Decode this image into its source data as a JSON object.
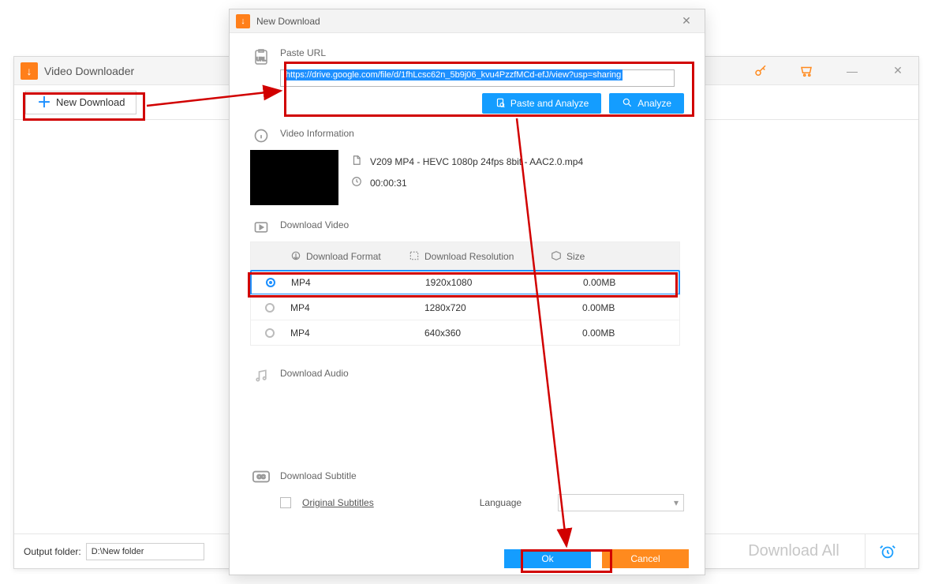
{
  "main": {
    "app_title": "Video Downloader",
    "new_download_btn": "New Download",
    "output_label": "Output folder:",
    "output_path": "D:\\New folder",
    "download_all": "Download All"
  },
  "dialog": {
    "title": "New Download",
    "paste_url_label": "Paste URL",
    "url_value": "https://drive.google.com/file/d/1fhLcsc62n_5b9j06_kvu4PzzfMCd-efJ/view?usp=sharing",
    "paste_analyze_btn": "Paste and Analyze",
    "analyze_btn": "Analyze",
    "video_info_label": "Video Information",
    "video_filename": "V209 MP4 - HEVC 1080p 24fps 8bit - AAC2.0.mp4",
    "video_duration": "00:00:31",
    "download_video_label": "Download Video",
    "col_format": "Download Format",
    "col_resolution": "Download Resolution",
    "col_size": "Size",
    "formats": [
      {
        "format": "MP4",
        "resolution": "1920x1080",
        "size": "0.00MB",
        "selected": true
      },
      {
        "format": "MP4",
        "resolution": "1280x720",
        "size": "0.00MB",
        "selected": false
      },
      {
        "format": "MP4",
        "resolution": "640x360",
        "size": "0.00MB",
        "selected": false
      }
    ],
    "download_audio_label": "Download Audio",
    "download_subtitle_label": "Download Subtitle",
    "original_subtitles": "Original Subtitles",
    "language_label": "Language",
    "ok": "Ok",
    "cancel": "Cancel"
  }
}
